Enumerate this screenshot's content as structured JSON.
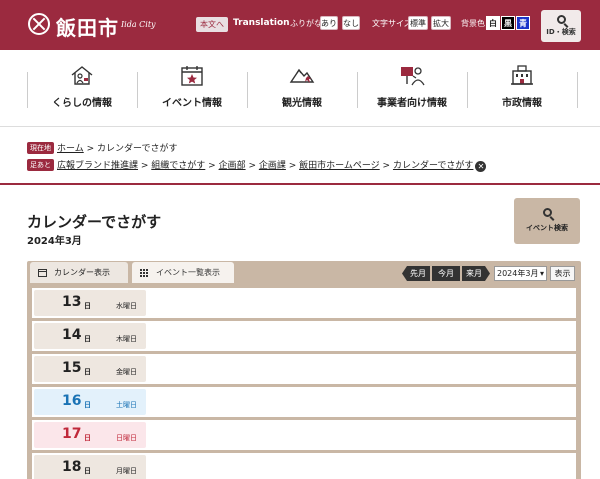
{
  "header": {
    "site_name": "飯田市",
    "site_name_en": "Iida City",
    "honbun": "本文へ",
    "translation": "Translation",
    "furigana": {
      "label": "ふりがな",
      "on": "あり",
      "off": "なし"
    },
    "font_size": {
      "label": "文字サイズ",
      "standard": "標準",
      "large": "拡大"
    },
    "bg_color": {
      "label": "背景色",
      "white": "白",
      "black": "黒",
      "blue": "青"
    },
    "search": "ID・検索",
    "colors": {
      "brand": "#9b2a3f",
      "accent_beige": "#c9b7a5"
    }
  },
  "nav": {
    "items": [
      {
        "label": "くらしの情報",
        "icon": "house-person-icon"
      },
      {
        "label": "イベント情報",
        "icon": "calendar-star-icon"
      },
      {
        "label": "観光情報",
        "icon": "mountain-leaf-icon"
      },
      {
        "label": "事業者向け情報",
        "icon": "presenter-board-icon"
      },
      {
        "label": "市政情報",
        "icon": "city-hall-icon"
      }
    ]
  },
  "breadcrumb": {
    "current_tag": "現在地",
    "current": {
      "home": "ホーム",
      "page": "カレンダーでさがす"
    },
    "trail_tag": "足あと",
    "trail": [
      "広報ブランド推進課",
      "組織でさがす",
      "企画部",
      "企画課",
      "飯田市ホームページ",
      "カレンダーでさがす"
    ]
  },
  "page": {
    "title": "カレンダーでさがす",
    "month": "2024年3月",
    "event_search": "イベント検索"
  },
  "calendar": {
    "tabs": {
      "calendar": "カレンダー表示",
      "list": "イベント一覧表示"
    },
    "prev": "先月",
    "current": "今月",
    "next": "来月",
    "selected_month": "2024年3月",
    "show": "表示",
    "days": [
      {
        "num": "13",
        "suffix": "日",
        "weekday": "水曜日",
        "type": "weekday"
      },
      {
        "num": "14",
        "suffix": "日",
        "weekday": "木曜日",
        "type": "weekday"
      },
      {
        "num": "15",
        "suffix": "日",
        "weekday": "金曜日",
        "type": "weekday"
      },
      {
        "num": "16",
        "suffix": "日",
        "weekday": "土曜日",
        "type": "saturday"
      },
      {
        "num": "17",
        "suffix": "日",
        "weekday": "日曜日",
        "type": "sunday"
      },
      {
        "num": "18",
        "suffix": "日",
        "weekday": "月曜日",
        "type": "weekday"
      }
    ],
    "day_colors": {
      "weekday": {
        "bg": "#eee7e0",
        "fg": "#222222"
      },
      "saturday": {
        "bg": "#e3f1fb",
        "fg": "#1a73b5"
      },
      "sunday": {
        "bg": "#fbe6ea",
        "fg": "#c0283a"
      }
    }
  }
}
